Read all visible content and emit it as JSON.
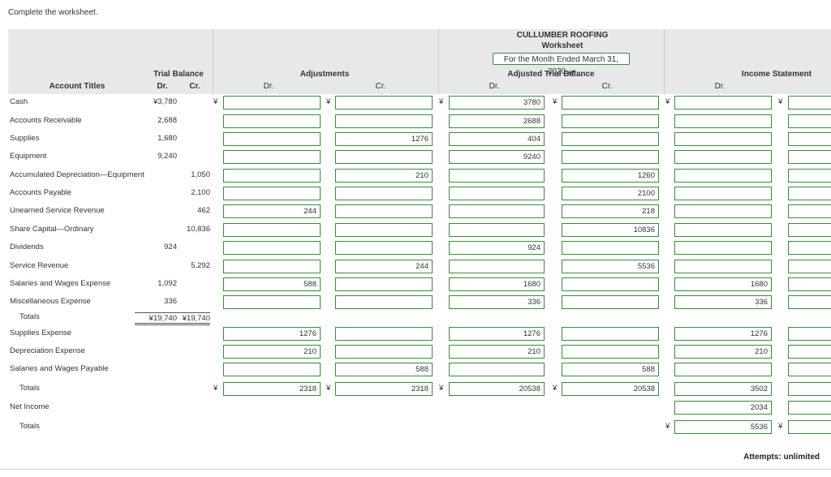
{
  "instruction": "Complete the worksheet.",
  "company": "CULLUMBER ROOFING",
  "worksheet_title": "Worksheet",
  "period": "For the Month Ended March 31, 2020",
  "columns": {
    "account_titles": "Account Titles",
    "trial_balance": "Trial Balance",
    "adjustments": "Adjustments",
    "adjusted_trial_balance": "Adjusted Trial Balance",
    "income_statement": "Income Statement",
    "dr": "Dr.",
    "cr": "Cr."
  },
  "currency": "¥",
  "rows": [
    {
      "label": "Cash",
      "tb_dr": "¥3,780",
      "tb_cr": "",
      "adj_dr": "",
      "adj_cr": "",
      "atb_dr": "3780",
      "atb_cr": "",
      "is_dr": ""
    },
    {
      "label": "Accounts Receivable",
      "tb_dr": "2,688",
      "tb_cr": "",
      "adj_dr": "",
      "adj_cr": "",
      "atb_dr": "2688",
      "atb_cr": "",
      "is_dr": ""
    },
    {
      "label": "Supplies",
      "tb_dr": "1,680",
      "tb_cr": "",
      "adj_dr": "",
      "adj_cr": "1276",
      "atb_dr": "404",
      "atb_cr": "",
      "is_dr": ""
    },
    {
      "label": "Equipment",
      "tb_dr": "9,240",
      "tb_cr": "",
      "adj_dr": "",
      "adj_cr": "",
      "atb_dr": "9240",
      "atb_cr": "",
      "is_dr": ""
    },
    {
      "label": "Accumulated Depreciation—Equipment",
      "tb_dr": "",
      "tb_cr": "1,050",
      "adj_dr": "",
      "adj_cr": "210",
      "atb_dr": "",
      "atb_cr": "1260",
      "is_dr": ""
    },
    {
      "label": "Accounts Payable",
      "tb_dr": "",
      "tb_cr": "2,100",
      "adj_dr": "",
      "adj_cr": "",
      "atb_dr": "",
      "atb_cr": "2100",
      "is_dr": ""
    },
    {
      "label": "Unearned Service Revenue",
      "tb_dr": "",
      "tb_cr": "462",
      "adj_dr": "244",
      "adj_cr": "",
      "atb_dr": "",
      "atb_cr": "218",
      "is_dr": ""
    },
    {
      "label": "Share Capital—Ordinary",
      "tb_dr": "",
      "tb_cr": "10,836",
      "adj_dr": "",
      "adj_cr": "",
      "atb_dr": "",
      "atb_cr": "10836",
      "is_dr": ""
    },
    {
      "label": "Dividends",
      "tb_dr": "924",
      "tb_cr": "",
      "adj_dr": "",
      "adj_cr": "",
      "atb_dr": "924",
      "atb_cr": "",
      "is_dr": ""
    },
    {
      "label": "Service Revenue",
      "tb_dr": "",
      "tb_cr": "5,292",
      "adj_dr": "",
      "adj_cr": "244",
      "atb_dr": "",
      "atb_cr": "5536",
      "is_dr": ""
    },
    {
      "label": "Salaries and Wages Expense",
      "tb_dr": "1,092",
      "tb_cr": "",
      "adj_dr": "588",
      "adj_cr": "",
      "atb_dr": "1680",
      "atb_cr": "",
      "is_dr": "1680"
    },
    {
      "label": "Miscellaneous Expense",
      "tb_dr": "336",
      "tb_cr": "",
      "adj_dr": "",
      "adj_cr": "",
      "atb_dr": "336",
      "atb_cr": "",
      "is_dr": "336"
    }
  ],
  "tb_totals": {
    "label": "Totals",
    "dr": "¥19,740",
    "cr": "¥19,740"
  },
  "rows2": [
    {
      "label": "Supplies Expense",
      "adj_dr": "1276",
      "adj_cr": "",
      "atb_dr": "1276",
      "atb_cr": "",
      "is_dr": "1276"
    },
    {
      "label": "Depreciation Expense",
      "adj_dr": "210",
      "adj_cr": "",
      "atb_dr": "210",
      "atb_cr": "",
      "is_dr": "210"
    },
    {
      "label": "Salaries and Wages Payable",
      "adj_dr": "",
      "adj_cr": "588",
      "atb_dr": "",
      "atb_cr": "588",
      "is_dr": ""
    }
  ],
  "totals": {
    "label": "Totals",
    "adj_dr": "2318",
    "adj_cr": "2318",
    "atb_dr": "20538",
    "atb_cr": "20538",
    "is_dr": "3502"
  },
  "net_income": {
    "label": "Net Income",
    "is_dr": "2034"
  },
  "final_totals": {
    "label": "Totals",
    "is_dr": "5536"
  },
  "attempts": "Attempts: unlimited"
}
